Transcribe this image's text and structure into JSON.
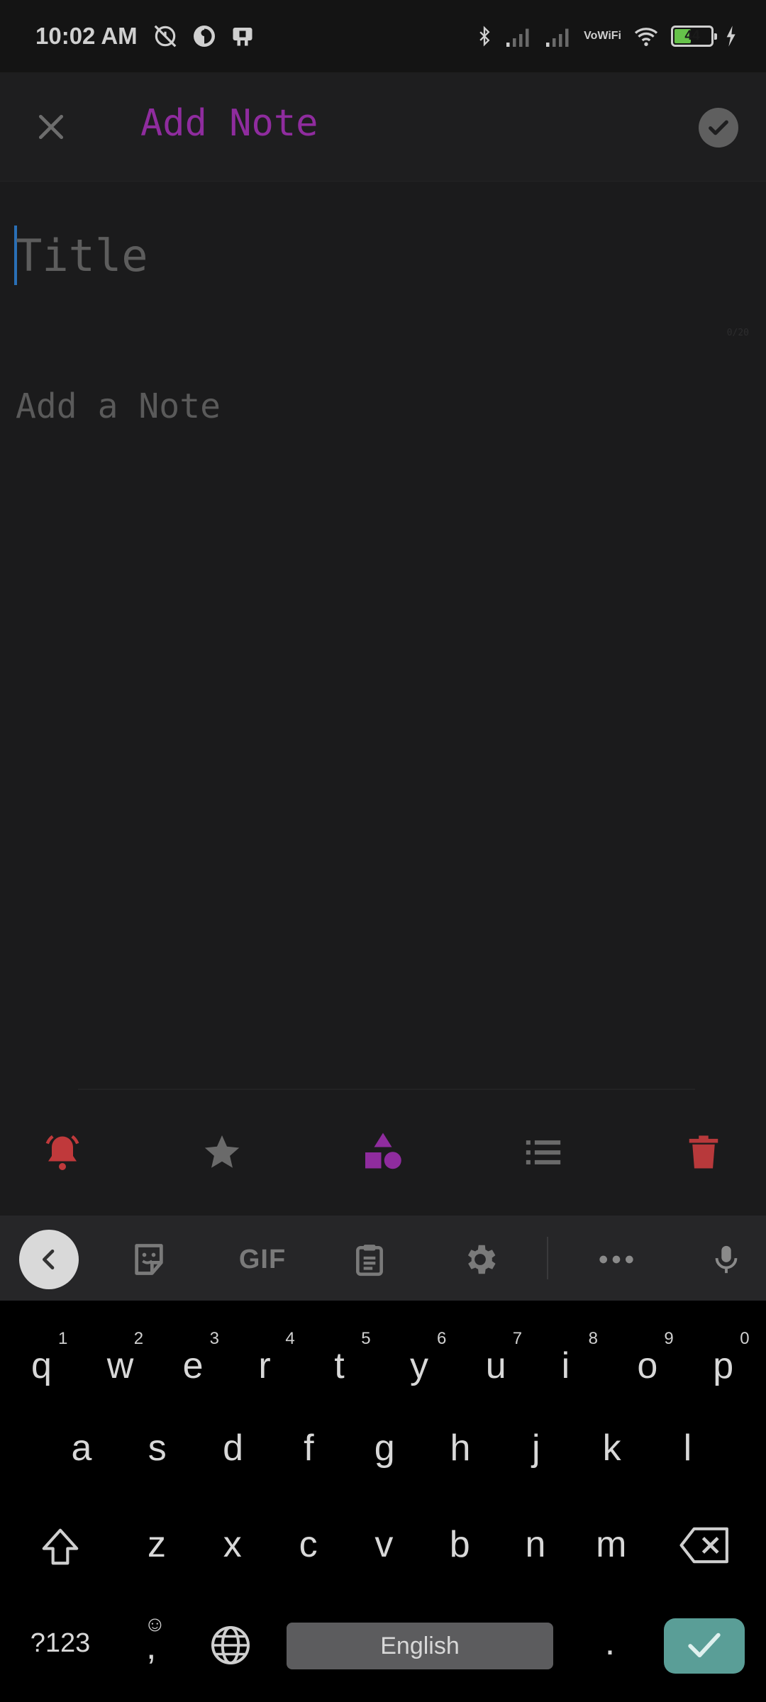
{
  "status_bar": {
    "time": "10:02 AM",
    "icons_left": [
      "alarm-off-icon",
      "data-saver-icon",
      "sim-icon"
    ],
    "icons_right": [
      "bluetooth-icon",
      "signal-icon",
      "signal-icon",
      "vowifi-icon",
      "wifi-icon",
      "battery-icon",
      "charging-icon"
    ],
    "vowifi_line1": "Vo",
    "vowifi_line2": "WiFi",
    "battery_level": "44",
    "battery_fraction": 0.44
  },
  "app_bar": {
    "title": "Add Note",
    "close_icon": "close-icon",
    "save_icon": "check-circle-icon",
    "title_color": "#8f2c9e"
  },
  "editor": {
    "title_placeholder": "Title",
    "note_placeholder": "Add a Note",
    "counter": "0/20"
  },
  "tools": [
    {
      "name": "reminder",
      "icon": "bell-icon",
      "color": "#c0393b"
    },
    {
      "name": "favorite",
      "icon": "star-icon",
      "color": "#6a6a6a"
    },
    {
      "name": "category",
      "icon": "shapes-icon",
      "color": "#8f2c9e"
    },
    {
      "name": "checklist",
      "icon": "list-icon",
      "color": "#6a6a6a"
    },
    {
      "name": "delete",
      "icon": "trash-icon",
      "color": "#b8393b"
    }
  ],
  "keyboard_toolbar": {
    "gif_label": "GIF",
    "icons": [
      "back-icon",
      "sticker-icon",
      "gif-icon",
      "clipboard-icon",
      "settings-icon",
      "more-icon",
      "microphone-icon"
    ]
  },
  "keyboard": {
    "row1": [
      {
        "k": "q",
        "h": "1"
      },
      {
        "k": "w",
        "h": "2"
      },
      {
        "k": "e",
        "h": "3"
      },
      {
        "k": "r",
        "h": "4"
      },
      {
        "k": "t",
        "h": "5"
      },
      {
        "k": "y",
        "h": "6"
      },
      {
        "k": "u",
        "h": "7"
      },
      {
        "k": "i",
        "h": "8"
      },
      {
        "k": "o",
        "h": "9"
      },
      {
        "k": "p",
        "h": "0"
      }
    ],
    "row2": [
      "a",
      "s",
      "d",
      "f",
      "g",
      "h",
      "j",
      "k",
      "l"
    ],
    "row3": [
      "z",
      "x",
      "c",
      "v",
      "b",
      "n",
      "m"
    ],
    "symbols_label": "?123",
    "comma_label": ",",
    "emoji_hint": "☺",
    "space_label": "English",
    "period_label": "."
  }
}
